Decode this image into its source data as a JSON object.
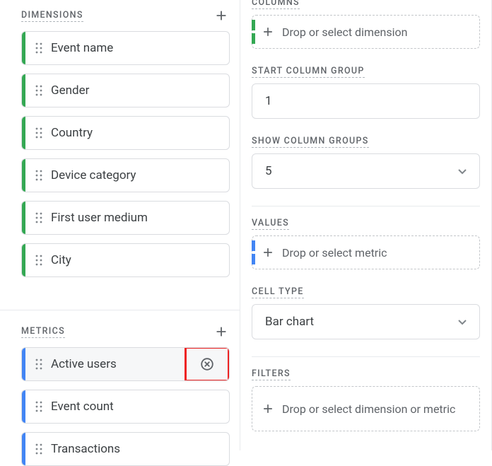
{
  "leftPanel": {
    "dimensions": {
      "title": "DIMENSIONS",
      "items": [
        {
          "label": "Event name"
        },
        {
          "label": "Gender"
        },
        {
          "label": "Country"
        },
        {
          "label": "Device category"
        },
        {
          "label": "First user medium"
        },
        {
          "label": "City"
        }
      ]
    },
    "metrics": {
      "title": "METRICS",
      "items": [
        {
          "label": "Active users",
          "selected": true,
          "removable": true
        },
        {
          "label": "Event count"
        },
        {
          "label": "Transactions"
        }
      ]
    }
  },
  "rightPanel": {
    "columns": {
      "title": "COLUMNS",
      "dropText": "Drop or select dimension"
    },
    "startColumnGroup": {
      "title": "START COLUMN GROUP",
      "value": "1"
    },
    "showColumnGroups": {
      "title": "SHOW COLUMN GROUPS",
      "value": "5"
    },
    "values": {
      "title": "VALUES",
      "dropText": "Drop or select metric"
    },
    "cellType": {
      "title": "CELL TYPE",
      "value": "Bar chart"
    },
    "filters": {
      "title": "FILTERS",
      "dropText": "Drop or select dimension or metric"
    }
  }
}
